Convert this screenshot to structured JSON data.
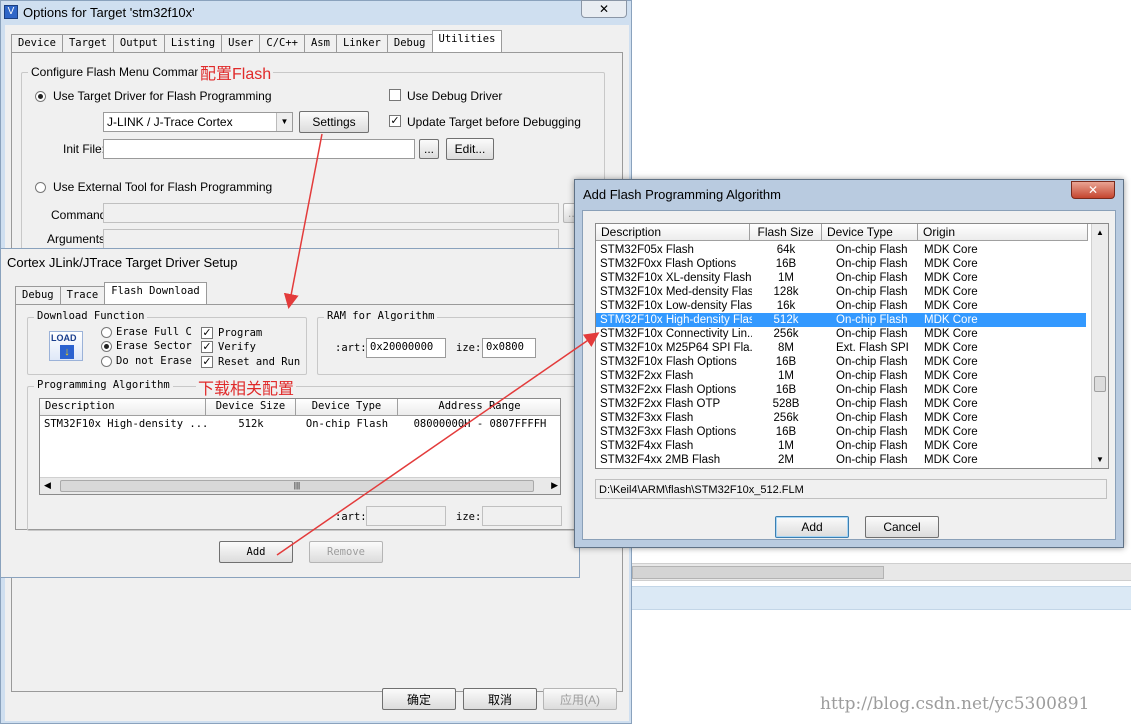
{
  "options_window": {
    "title": "Options for Target 'stm32f10x'",
    "close_label": "✕",
    "tabs": [
      "Device",
      "Target",
      "Output",
      "Listing",
      "User",
      "C/C++",
      "Asm",
      "Linker",
      "Debug",
      "Utilities"
    ],
    "active_tab": "Utilities",
    "flash_group_title": "Configure Flash Menu Command",
    "annotation_flash": "配置Flash",
    "use_target_driver": "Use Target Driver for Flash Programming",
    "use_debug_driver": "Use Debug Driver",
    "driver_value": "J-LINK / J-Trace Cortex",
    "settings_label": "Settings",
    "update_target": "Update Target before Debugging",
    "init_file_label": "Init File:",
    "browse_label": "...",
    "edit_label": "Edit...",
    "use_external_tool": "Use External Tool for Flash Programming",
    "command_label": "Command:",
    "arguments_label": "Arguments:",
    "ok_label": "确定",
    "cancel_label": "取消",
    "apply_label": "应用(A)"
  },
  "driver_setup": {
    "title": "Cortex JLink/JTrace Target Driver Setup",
    "tabs": [
      "Debug",
      "Trace",
      "Flash Download"
    ],
    "active_tab": "Flash Download",
    "download_function_title": "Download Function",
    "load_icon_text": "LOAD",
    "erase_full": "Erase Full C",
    "erase_sector": "Erase Sector",
    "do_not_erase": "Do not Erase",
    "program": "Program",
    "verify": "Verify",
    "reset_run": "Reset and Run",
    "ram_group_title": "RAM for Algorithm",
    "start_label": ":art:",
    "start_value": "0x20000000",
    "size_label": "ize:",
    "size_value": "0x0800",
    "programming_algorithm_title": "Programming Algorithm",
    "annotation_download": "下载相关配置",
    "columns": [
      "Description",
      "Device Size",
      "Device Type",
      "Address Range"
    ],
    "rows": [
      {
        "description": "STM32F10x High-density ...",
        "size": "512k",
        "type": "On-chip Flash",
        "range": "08000000H - 0807FFFFH"
      }
    ],
    "start_label2": ":art:",
    "size_label2": "ize:",
    "add_label": "Add",
    "remove_label": "Remove"
  },
  "add_algorithm": {
    "title": "Add Flash Programming Algorithm",
    "close_label": "✕",
    "columns": [
      "Description",
      "Flash Size",
      "Device Type",
      "Origin"
    ],
    "rows": [
      {
        "description": "STM32F05x Flash",
        "size": "64k",
        "type": "On-chip Flash",
        "origin": "MDK Core"
      },
      {
        "description": "STM32F0xx Flash Options",
        "size": "16B",
        "type": "On-chip Flash",
        "origin": "MDK Core"
      },
      {
        "description": "STM32F10x XL-density Flash",
        "size": "1M",
        "type": "On-chip Flash",
        "origin": "MDK Core"
      },
      {
        "description": "STM32F10x Med-density Flash",
        "size": "128k",
        "type": "On-chip Flash",
        "origin": "MDK Core"
      },
      {
        "description": "STM32F10x Low-density Flash",
        "size": "16k",
        "type": "On-chip Flash",
        "origin": "MDK Core"
      },
      {
        "description": "STM32F10x High-density Flash",
        "size": "512k",
        "type": "On-chip Flash",
        "origin": "MDK Core"
      },
      {
        "description": "STM32F10x Connectivity Lin...",
        "size": "256k",
        "type": "On-chip Flash",
        "origin": "MDK Core"
      },
      {
        "description": "STM32F10x M25P64 SPI Fla...",
        "size": "8M",
        "type": "Ext. Flash SPI",
        "origin": "MDK Core"
      },
      {
        "description": "STM32F10x Flash Options",
        "size": "16B",
        "type": "On-chip Flash",
        "origin": "MDK Core"
      },
      {
        "description": "STM32F2xx Flash",
        "size": "1M",
        "type": "On-chip Flash",
        "origin": "MDK Core"
      },
      {
        "description": "STM32F2xx Flash Options",
        "size": "16B",
        "type": "On-chip Flash",
        "origin": "MDK Core"
      },
      {
        "description": "STM32F2xx Flash OTP",
        "size": "528B",
        "type": "On-chip Flash",
        "origin": "MDK Core"
      },
      {
        "description": "STM32F3xx Flash",
        "size": "256k",
        "type": "On-chip Flash",
        "origin": "MDK Core"
      },
      {
        "description": "STM32F3xx Flash Options",
        "size": "16B",
        "type": "On-chip Flash",
        "origin": "MDK Core"
      },
      {
        "description": "STM32F4xx Flash",
        "size": "1M",
        "type": "On-chip Flash",
        "origin": "MDK Core"
      },
      {
        "description": "STM32F4xx 2MB Flash",
        "size": "2M",
        "type": "On-chip Flash",
        "origin": "MDK Core"
      }
    ],
    "selected_row": "STM32F10x High-density Flash",
    "path": "D:\\Keil4\\ARM\\flash\\STM32F10x_512.FLM",
    "add_label": "Add",
    "cancel_label": "Cancel"
  },
  "watermark": "http://blog.csdn.net/yc5300891",
  "colors": {
    "annotation": "#e02a2a",
    "selection": "#3399ff",
    "arrow": "#e33b3b"
  }
}
